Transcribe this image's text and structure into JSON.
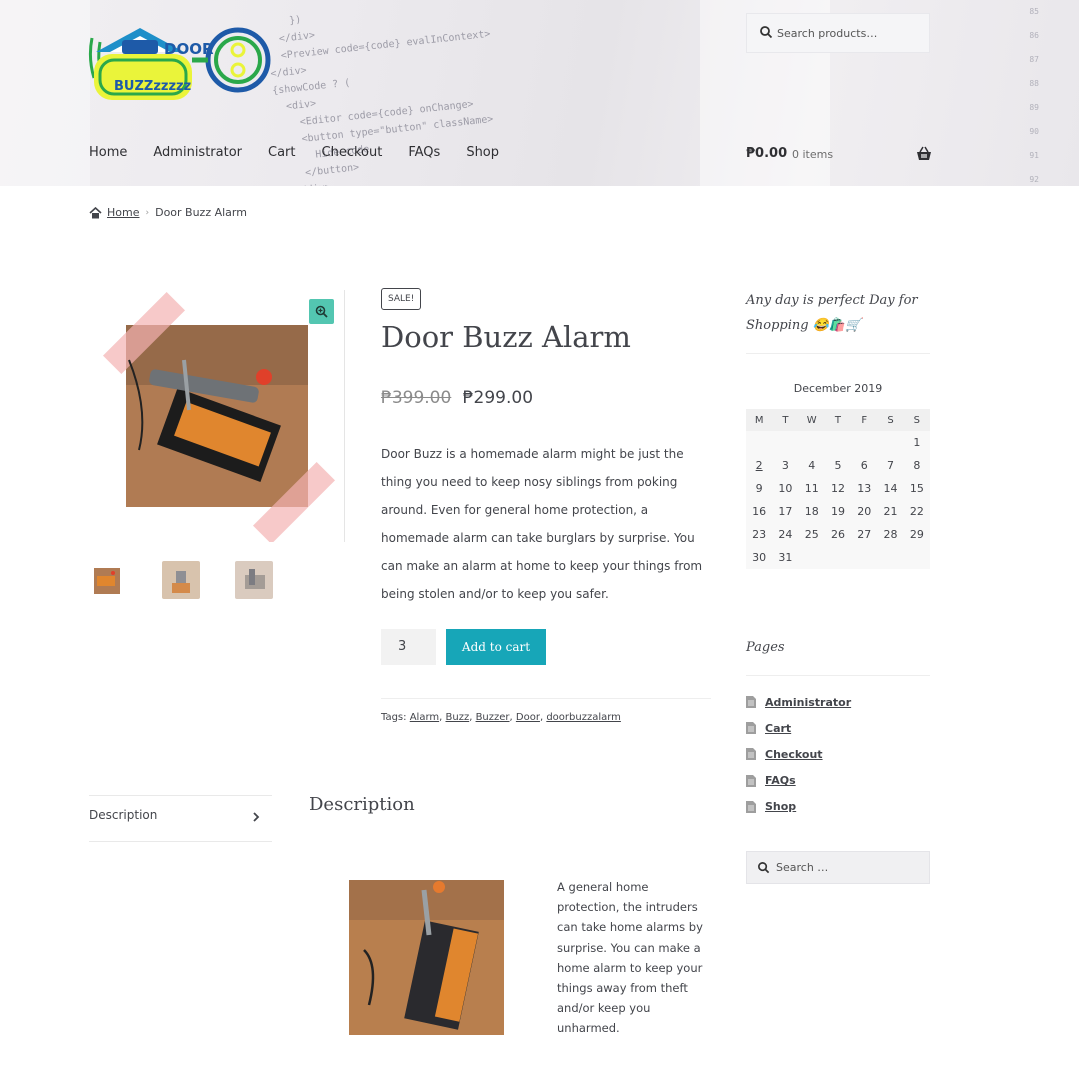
{
  "header": {
    "logo_text_1": "DOOR",
    "logo_text_2": "BUZZzzzzz",
    "search_placeholder": "Search products…",
    "nav": [
      "Home",
      "Administrator",
      "Cart",
      "Checkout",
      "FAQs",
      "Shop"
    ],
    "cart_amount": "₱0.00",
    "cart_items": "0 items"
  },
  "breadcrumb": {
    "home": "Home",
    "separator": "›",
    "current": "Door Buzz Alarm"
  },
  "product": {
    "badge": "SALE!",
    "title": "Door Buzz Alarm",
    "regular_price": "₱399.00",
    "sale_price": "₱299.00",
    "description": "Door Buzz is a homemade alarm might be just the thing you need to keep nosy siblings from poking around. Even for general home protection, a homemade alarm can take burglars by surprise. You can make an alarm at home to keep your things from being stolen and/or to keep you safer.",
    "quantity": "3",
    "add_to_cart": "Add to cart",
    "tags_label": "Tags:",
    "tags": [
      "Alarm",
      "Buzz",
      "Buzzer",
      "Door",
      "doorbuzzalarm"
    ]
  },
  "tabs": {
    "tab_label": "Description",
    "heading": "Description",
    "text": "A general home protection, the intruders can take home alarms by surprise. You can make a home alarm to keep your things away from theft and/or keep you unharmed."
  },
  "sidebar": {
    "promo": "Any day is perfect Day for Shopping 😂🛍️🛒",
    "calendar": {
      "caption": "December 2019",
      "weekdays": [
        "M",
        "T",
        "W",
        "T",
        "F",
        "S",
        "S"
      ],
      "weeks": [
        [
          "",
          "",
          "",
          "",
          "",
          "",
          "1"
        ],
        [
          "2",
          "3",
          "4",
          "5",
          "6",
          "7",
          "8"
        ],
        [
          "9",
          "10",
          "11",
          "12",
          "13",
          "14",
          "15"
        ],
        [
          "16",
          "17",
          "18",
          "19",
          "20",
          "21",
          "22"
        ],
        [
          "23",
          "24",
          "25",
          "26",
          "27",
          "28",
          "29"
        ],
        [
          "30",
          "31",
          "",
          "",
          "",
          "",
          ""
        ]
      ],
      "linked_day": "2"
    },
    "pages_heading": "Pages",
    "pages": [
      "Administrator",
      "Cart",
      "Checkout",
      "FAQs",
      "Shop"
    ],
    "search_placeholder": "Search …"
  },
  "colors": {
    "accent_teal": "#17a6b8",
    "zoom_button": "#53c6b1",
    "text": "#43454b"
  }
}
